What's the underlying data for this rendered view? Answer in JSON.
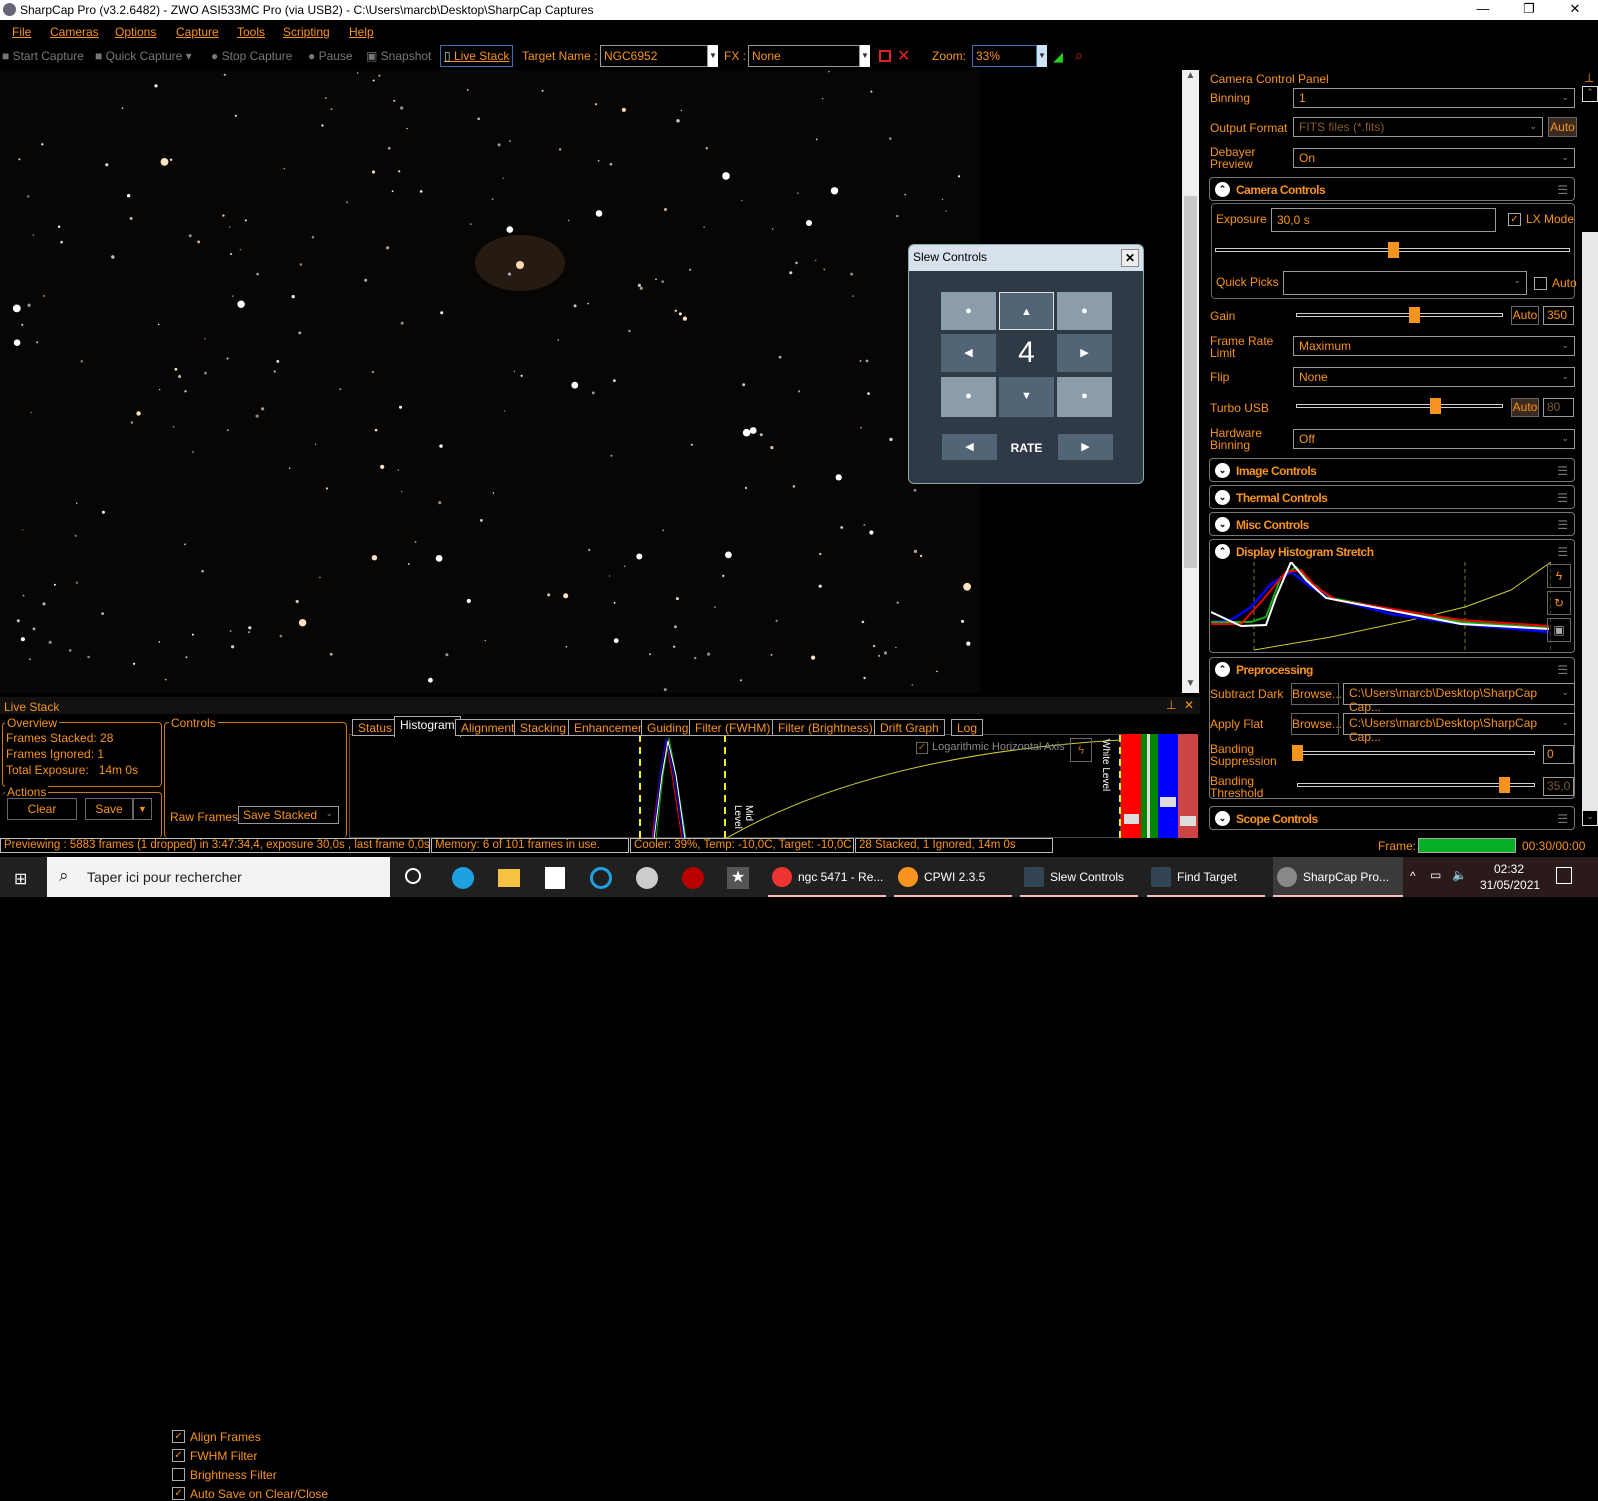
{
  "window": {
    "title": "SharpCap Pro (v3.2.6482) - ZWO ASI533MC Pro (via USB2) - C:\\Users\\marcb\\Desktop\\SharpCap Captures",
    "minimize": "—",
    "maximize": "❐",
    "close": "✕"
  },
  "menu": [
    "File",
    "Cameras",
    "Options",
    "Capture",
    "Tools",
    "Scripting",
    "Help"
  ],
  "toolbar": {
    "start_capture": "Start Capture",
    "quick_capture": "Quick Capture",
    "stop_capture": "Stop Capture",
    "pause": "Pause",
    "snapshot": "Snapshot",
    "live_stack": "Live Stack",
    "target_label": "Target Name :",
    "target_value": "NGC6952",
    "fx_label": "FX :",
    "fx_value": "None",
    "zoom_label": "Zoom:",
    "zoom_value": "33%"
  },
  "slew": {
    "title": "Slew Controls",
    "close": "✕",
    "rate_value": "4",
    "rate_label": "RATE",
    "up": "▲",
    "down": "▼",
    "left": "◀",
    "right": "▶",
    "dot": "●"
  },
  "camera_panel": {
    "title": "Camera Control Panel",
    "binning": {
      "label": "Binning",
      "value": "1"
    },
    "output_format": {
      "label": "Output Format",
      "value": "FITS files (*.fits)",
      "auto": "Auto"
    },
    "debayer": {
      "label": "Debayer Preview",
      "value": "On"
    },
    "camera_controls": {
      "title": "Camera Controls",
      "exposure_label": "Exposure",
      "exposure_value": "30,0 s",
      "lx_mode": "LX Mode",
      "lx_checked": true,
      "exposure_slider": 0.5,
      "quick_picks": "Quick Picks",
      "quick_auto": "Auto",
      "gain": {
        "label": "Gain",
        "auto": "Auto",
        "value": "350",
        "slider": 0.57
      },
      "frame_rate": {
        "label": "Frame Rate Limit",
        "value": "Maximum"
      },
      "flip": {
        "label": "Flip",
        "value": "None"
      },
      "turbo": {
        "label": "Turbo USB",
        "auto": "Auto",
        "value": "80",
        "slider": 0.67
      },
      "hw_binning": {
        "label": "Hardware Binning",
        "value": "Off"
      }
    },
    "sections": [
      "Image Controls",
      "Thermal Controls",
      "Misc Controls"
    ],
    "histogram": {
      "title": "Display Histogram Stretch"
    },
    "preprocessing": {
      "title": "Preprocessing",
      "subtract_dark": "Subtract Dark",
      "apply_flat": "Apply Flat",
      "browse": "Browse...",
      "dark_path": "C:\\Users\\marcb\\Desktop\\SharpCap Cap...",
      "flat_path": "C:\\Users\\marcb\\Desktop\\SharpCap Cap...",
      "banding_suppression": "Banding Suppression",
      "banding_suppression_value": "0",
      "banding_threshold": "Banding Threshold",
      "banding_threshold_value": "35,0",
      "suppression_slider": 0,
      "threshold_slider": 0.87
    },
    "scope": {
      "title": "Scope Controls"
    }
  },
  "live_stack": {
    "title": "Live Stack",
    "overview": "Overview",
    "frames_stacked": "Frames Stacked: 28",
    "frames_ignored": "Frames Ignored:  1",
    "total_exposure": "Total Exposure:   14m 0s",
    "actions": "Actions",
    "clear": "Clear",
    "save": "Save",
    "controls": "Controls",
    "checks": [
      {
        "label": "Align Frames",
        "checked": true
      },
      {
        "label": "FWHM Filter",
        "checked": true
      },
      {
        "label": "Brightness Filter",
        "checked": false
      },
      {
        "label": "Auto Save on Clear/Close",
        "checked": true
      }
    ],
    "raw_frames": "Raw Frames",
    "raw_frames_value": "Save Stacked",
    "tabs": [
      "Status",
      "Histogram",
      "Alignment",
      "Stacking",
      "Enhancement",
      "Guiding",
      "Filter (FWHM)",
      "Filter (Brightness)",
      "Drift Graph",
      "Log"
    ],
    "active_tab": "Histogram",
    "log_axis": "Logarithmic Horizontal Axis",
    "mid_level": "Mid Level",
    "white_level": "White Level"
  },
  "status": {
    "preview": "Previewing : 5883 frames (1 dropped) in 3:47:34,4, exposure 30,0s , last frame 0,0s",
    "memory": "Memory: 6 of 101 frames in use.",
    "cooler": "Cooler: 39%, Temp: -10,0C, Target: -10,0C",
    "stacked": "28 Stacked, 1 Ignored, 14m 0s",
    "frame_label": "Frame:",
    "frame_time": "00:30/00:00",
    "frame_progress": 1.0
  },
  "taskbar": {
    "search": "Taper ici pour rechercher",
    "tasks": [
      "ngc 5471 - Re...",
      "CPWI 2.3.5",
      "Slew Controls",
      "Find Target",
      "SharpCap Pro..."
    ],
    "time": "02:32",
    "date": "31/05/2021"
  }
}
